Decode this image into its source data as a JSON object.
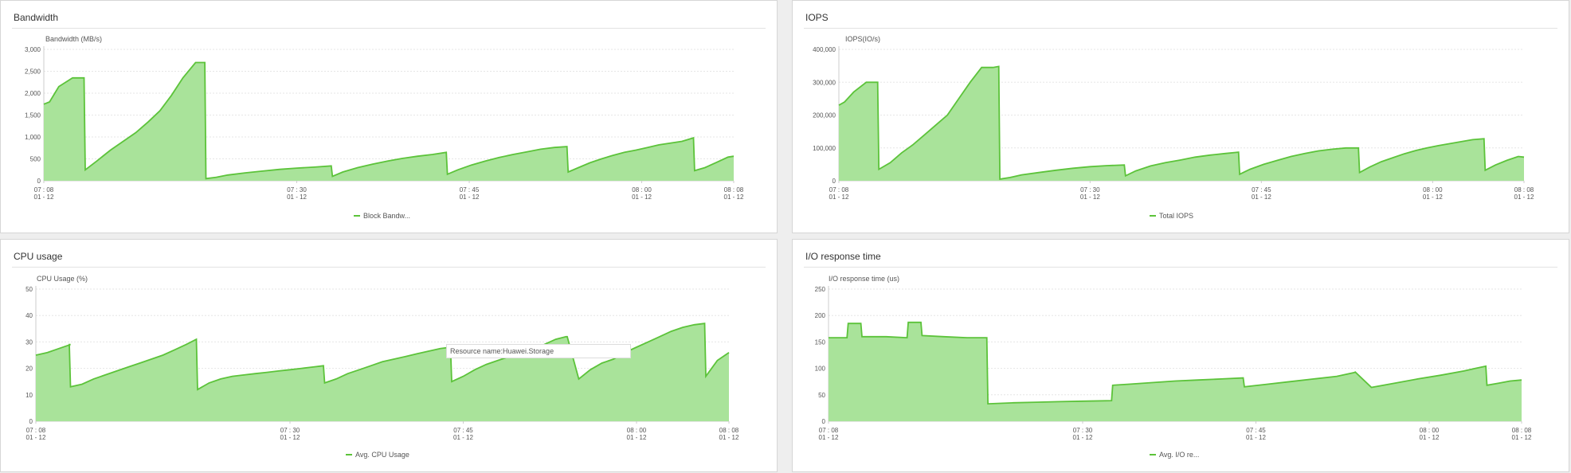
{
  "panels": [
    {
      "id": "bandwidth",
      "title": "Bandwidth",
      "chart_data": {
        "type": "area",
        "ylabel": "Bandwidth (MB/s)",
        "ylim": [
          0,
          3000
        ],
        "yticks": [
          "0",
          "500",
          "1,000",
          "1,500",
          "2,000",
          "2,500",
          "3,000"
        ],
        "xlim": [
          0,
          60
        ],
        "xticks": [
          {
            "t": 0,
            "time": "07 : 08",
            "date": "01 - 12"
          },
          {
            "t": 22,
            "time": "07 : 30",
            "date": "01 - 12"
          },
          {
            "t": 37,
            "time": "07 : 45",
            "date": "01 - 12"
          },
          {
            "t": 52,
            "time": "08 : 00",
            "date": "01 - 12"
          },
          {
            "t": 60,
            "time": "08 : 08",
            "date": "01 - 12"
          }
        ],
        "series": [
          {
            "name": "Block Bandw...",
            "x": [
              0,
              0.5,
              1.3,
              2.5,
              3.5,
              3.6,
              4.6,
              5.8,
              6.9,
              8,
              9.1,
              10.1,
              11.1,
              12.1,
              13.2,
              14,
              14.1,
              15,
              16,
              17.5,
              19,
              20.5,
              22,
              23.5,
              25,
              25.1,
              26,
              27.3,
              28.6,
              29.9,
              31.2,
              32.5,
              33.8,
              35,
              35.1,
              36,
              37.2,
              38.4,
              39.6,
              40.8,
              42,
              43.2,
              44.4,
              45.5,
              45.6,
              46.5,
              47.5,
              48.5,
              49.5,
              50.5,
              51.5,
              52.5,
              53.5,
              55.5,
              56.5,
              56.6,
              57.5,
              58.5,
              59.5,
              60
            ],
            "values": [
              1750,
              1800,
              2150,
              2350,
              2350,
              250,
              450,
              700,
              900,
              1100,
              1350,
              1600,
              1950,
              2350,
              2700,
              2700,
              50,
              80,
              130,
              180,
              220,
              260,
              290,
              310,
              340,
              100,
              200,
              300,
              380,
              450,
              510,
              560,
              600,
              650,
              150,
              250,
              360,
              450,
              530,
              600,
              660,
              720,
              760,
              780,
              200,
              300,
              410,
              500,
              580,
              650,
              700,
              760,
              820,
              900,
              980,
              230,
              300,
              420,
              540,
              560
            ]
          }
        ]
      }
    },
    {
      "id": "iops",
      "title": "IOPS",
      "chart_data": {
        "type": "area",
        "ylabel": "IOPS(IO/s)",
        "ylim": [
          0,
          400000
        ],
        "yticks": [
          "0",
          "100,000",
          "200,000",
          "300,000",
          "400,000"
        ],
        "xlim": [
          0,
          60
        ],
        "xticks": [
          {
            "t": 0,
            "time": "07 : 08",
            "date": "01 - 12"
          },
          {
            "t": 22,
            "time": "07 : 30",
            "date": "01 - 12"
          },
          {
            "t": 37,
            "time": "07 : 45",
            "date": "01 - 12"
          },
          {
            "t": 52,
            "time": "08 : 00",
            "date": "01 - 12"
          },
          {
            "t": 60,
            "time": "08 : 08",
            "date": "01 - 12"
          }
        ],
        "series": [
          {
            "name": "Total IOPS",
            "x": [
              0,
              0.5,
              1.3,
              2.4,
              3.4,
              3.5,
              4.5,
              5.5,
              6.5,
              7.5,
              8.5,
              9.5,
              10.5,
              11.5,
              12.5,
              13.5,
              14,
              14.1,
              15,
              16,
              17.5,
              19,
              20.5,
              22,
              23.5,
              25,
              25.1,
              26,
              27.3,
              28.6,
              29.9,
              31.2,
              32.5,
              33.8,
              35,
              35.1,
              36,
              37.2,
              38.4,
              39.6,
              40.8,
              42,
              43.2,
              44.4,
              45.5,
              45.6,
              46.5,
              47.5,
              48.5,
              49.5,
              50.5,
              51.5,
              52.5,
              53.5,
              55.5,
              56.5,
              56.6,
              57.5,
              58.5,
              59.5,
              60
            ],
            "values": [
              230000,
              240000,
              270000,
              300000,
              300000,
              35000,
              55000,
              85000,
              110000,
              140000,
              170000,
              200000,
              250000,
              300000,
              345000,
              345000,
              348000,
              5000,
              10000,
              18000,
              25000,
              32000,
              38000,
              43000,
              46000,
              48000,
              15000,
              30000,
              45000,
              55000,
              63000,
              72000,
              78000,
              83000,
              87000,
              20000,
              35000,
              50000,
              62000,
              74000,
              83000,
              91000,
              96000,
              100000,
              100000,
              25000,
              42000,
              58000,
              70000,
              82000,
              92000,
              100000,
              107000,
              113000,
              125000,
              128000,
              32000,
              48000,
              62000,
              74000,
              72000
            ]
          }
        ]
      }
    },
    {
      "id": "cpu",
      "title": "CPU usage",
      "chart_data": {
        "type": "area",
        "ylabel": "CPU Usage (%)",
        "ylim": [
          0,
          50
        ],
        "yticks": [
          "0",
          "10",
          "20",
          "30",
          "40",
          "50"
        ],
        "xlim": [
          0,
          60
        ],
        "xticks": [
          {
            "t": 0,
            "time": "07 : 08",
            "date": "01 - 12"
          },
          {
            "t": 22,
            "time": "07 : 30",
            "date": "01 - 12"
          },
          {
            "t": 37,
            "time": "07 : 45",
            "date": "01 - 12"
          },
          {
            "t": 52,
            "time": "08 : 00",
            "date": "01 - 12"
          },
          {
            "t": 60,
            "time": "08 : 08",
            "date": "01 - 12"
          }
        ],
        "series": [
          {
            "name": "Avg. CPU Usage",
            "x": [
              0,
              1,
              2,
              3,
              2.9,
              3,
              4,
              5,
              6,
              7,
              8,
              9,
              10,
              11,
              12,
              13,
              13.9,
              14,
              15,
              16,
              17,
              18,
              19,
              20,
              21,
              22,
              23,
              24,
              24.9,
              25,
              26,
              27,
              28,
              29,
              30,
              31,
              32,
              33,
              34,
              35,
              35.9,
              36,
              37,
              38,
              39,
              40,
              41,
              42,
              43,
              44,
              45,
              45.9,
              46,
              47,
              48,
              49,
              50,
              51,
              52,
              53,
              54,
              55,
              56,
              57,
              57.9,
              58,
              59,
              60
            ],
            "values": [
              25,
              26,
              27.5,
              29,
              29,
              13,
              14,
              16,
              17.5,
              19,
              20.5,
              22,
              23.5,
              25,
              27,
              29,
              31,
              12,
              14.5,
              16,
              17,
              17.5,
              18,
              18.5,
              19,
              19.5,
              20,
              20.5,
              21,
              14.5,
              16,
              18,
              19.5,
              21,
              22.5,
              23.5,
              24.5,
              25.5,
              26.5,
              27.5,
              28,
              15,
              17,
              19.5,
              21.5,
              23,
              24.5,
              26,
              27.5,
              29,
              31,
              32,
              32,
              16,
              19.5,
              22,
              23.5,
              26,
              28,
              30,
              32,
              34,
              35.5,
              36.5,
              37,
              17,
              23,
              26
            ]
          }
        ]
      },
      "tooltip": "Resource name:Huawei.Storage"
    },
    {
      "id": "iorsp",
      "title": "I/O response time",
      "chart_data": {
        "type": "area",
        "ylabel": "I/O response time (us)",
        "ylim": [
          0,
          250
        ],
        "yticks": [
          "0",
          "50",
          "100",
          "150",
          "200",
          "250"
        ],
        "xlim": [
          0,
          60
        ],
        "xticks": [
          {
            "t": 0,
            "time": "07 : 08",
            "date": "01 - 12"
          },
          {
            "t": 22,
            "time": "07 : 30",
            "date": "01 - 12"
          },
          {
            "t": 37,
            "time": "07 : 45",
            "date": "01 - 12"
          },
          {
            "t": 52,
            "time": "08 : 00",
            "date": "01 - 12"
          },
          {
            "t": 60,
            "time": "08 : 08",
            "date": "01 - 12"
          }
        ],
        "series": [
          {
            "name": "Avg. I/O re...",
            "x": [
              0,
              1.6,
              1.7,
              2.8,
              2.9,
              5,
              6.8,
              6.9,
              8,
              8.1,
              10,
              12,
              13.7,
              13.8,
              16,
              18,
              20,
              22,
              24.5,
              24.6,
              26,
              28,
              30,
              32,
              34,
              35.9,
              36,
              38,
              40,
              42,
              44,
              45.5,
              45.6,
              47,
              49,
              51,
              53,
              55,
              56,
              56.9,
              57,
              58,
              59,
              60
            ],
            "values": [
              158,
              158,
              185,
              185,
              160,
              160,
              158,
              187,
              187,
              162,
              160,
              158,
              158,
              33,
              35,
              36,
              37,
              38,
              39,
              68,
              70,
              73,
              76,
              78,
              80,
              82,
              65,
              70,
              75,
              80,
              85,
              92,
              93,
              64,
              72,
              80,
              87,
              95,
              100,
              104,
              68,
              72,
              76,
              78
            ]
          }
        ]
      }
    }
  ]
}
